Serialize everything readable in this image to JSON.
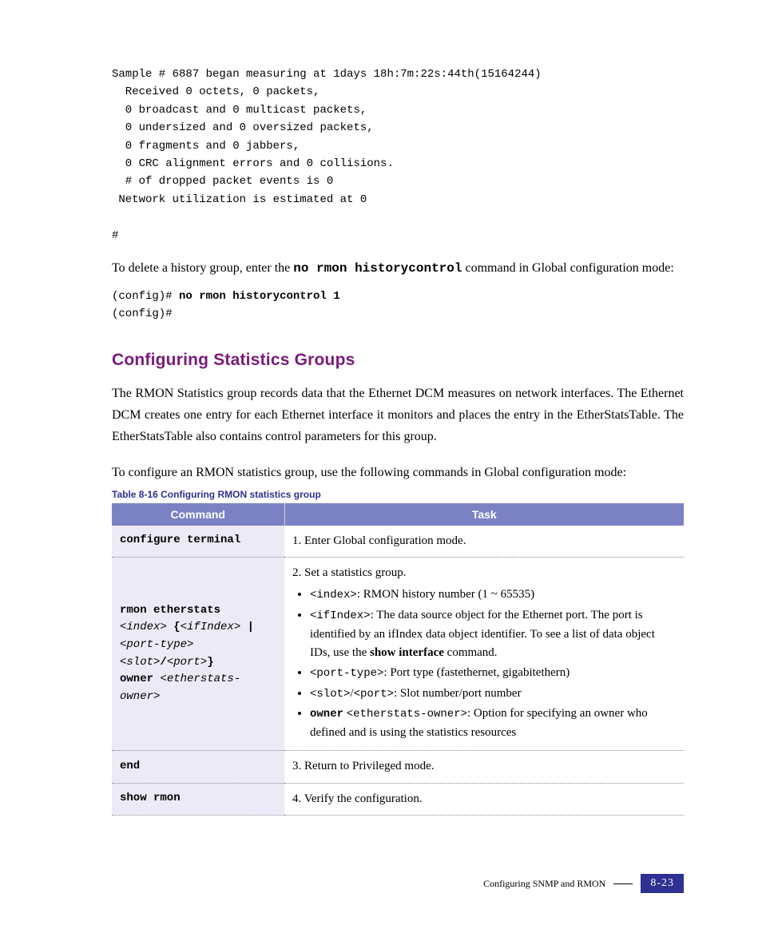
{
  "code1": {
    "l1": "Sample # 6887 began measuring at 1days 18h:7m:22s:44th(15164244)",
    "l2": "  Received 0 octets, 0 packets,",
    "l3": "  0 broadcast and 0 multicast packets,",
    "l4": "  0 undersized and 0 oversized packets,",
    "l5": "  0 fragments and 0 jabbers,",
    "l6": "  0 CRC alignment errors and 0 collisions.",
    "l7": "  # of dropped packet events is 0",
    "l8": " Network utilization is estimated at 0",
    "l9": "",
    "l10": "#"
  },
  "para1": {
    "pre": "To delete a history group, enter the ",
    "cmd": "no rmon historycontrol",
    "post": " command in Global configuration mode:"
  },
  "code2": {
    "l1a": "(config)# ",
    "l1b": "no rmon historycontrol 1",
    "l2": "(config)#"
  },
  "h2": "Configuring Statistics Groups",
  "para2": "The RMON Statistics group records data that the Ethernet DCM measures on network interfaces. The Ethernet DCM creates one entry for each Ethernet interface it monitors and places the entry in the EtherStatsTable. The EtherStatsTable also contains control parameters for this group.",
  "para3": "To configure an RMON statistics group, use the following commands in Global configuration mode:",
  "caption": "Table 8-16   Configuring RMON statistics group",
  "th": {
    "c1": "Command",
    "c2": "Task"
  },
  "row1": {
    "cmd": "configure terminal",
    "task": "1.  Enter Global configuration mode."
  },
  "row2": {
    "cmd_l1": "rmon etherstats",
    "cmd_l2a": "<index>",
    "cmd_l2b": " {",
    "cmd_l2c": "<ifIndex>",
    "cmd_l2d": " |",
    "cmd_l3a": "<port-type>",
    "cmd_l4a": "<slot>",
    "cmd_l4b": "/",
    "cmd_l4c": "<port>",
    "cmd_l4d": "}",
    "cmd_l5a": "owner ",
    "cmd_l5b": "<etherstats-",
    "cmd_l6": "owner>",
    "task_top": "2. Set a statistics group.",
    "b1a": "<index>",
    "b1b": ": RMON history number (1 ~ 65535)",
    "b2a": "<ifIndex>",
    "b2b": ": The data source object for the Ethernet port. The port is identified by an ifIndex data object identifier. To see a list of data object IDs, use the ",
    "b2c": "show interface",
    "b2d": " command.",
    "b3a": "<port-type>",
    "b3b": ": Port type (fastethernet, gigabitethern)",
    "b4a": "<slot>",
    "b4b": "/",
    "b4c": "<port>",
    "b4d": ": Slot number/port number",
    "b5a": "owner",
    "b5b": " ",
    "b5c": "<etherstats-owner>",
    "b5d": ": Option for specifying an owner who defined and is using the statistics resources"
  },
  "row3": {
    "cmd": "end",
    "task": "3. Return to Privileged mode."
  },
  "row4": {
    "cmd": "show rmon",
    "task": "4. Verify the configuration."
  },
  "footer": {
    "text": "Configuring SNMP and RMON",
    "page": "8-23"
  }
}
